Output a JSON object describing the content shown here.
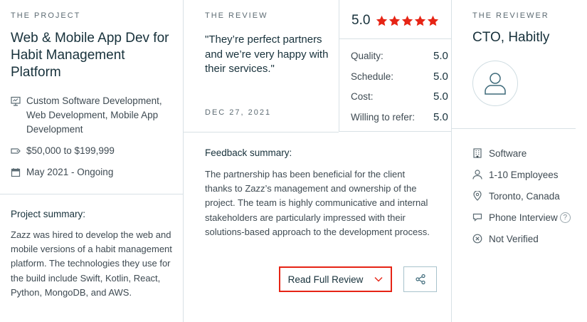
{
  "project": {
    "eyebrow": "THE PROJECT",
    "title": "Web & Mobile App Dev for Habit Management Platform",
    "services": "Custom Software Development, Web Development, Mobile App Development",
    "budget": "$50,000 to $199,999",
    "timeline": "May 2021 - Ongoing",
    "summary_label": "Project summary:",
    "summary_text": "Zazz was hired to develop the web and mobile versions of a habit management platform. The technologies they use for the build include Swift, Kotlin, React, Python, MongoDB, and AWS."
  },
  "review": {
    "eyebrow": "THE REVIEW",
    "quote": "\"They’re perfect partners and we’re very happy with their services.\"",
    "date": "DEC 27, 2021",
    "overall": "5.0",
    "stars": 5,
    "scores": [
      {
        "label": "Quality:",
        "value": "5.0"
      },
      {
        "label": "Schedule:",
        "value": "5.0"
      },
      {
        "label": "Cost:",
        "value": "5.0"
      },
      {
        "label": "Willing to refer:",
        "value": "5.0"
      }
    ],
    "feedback_label": "Feedback summary:",
    "feedback_text": "The partnership has been beneficial for the client thanks to Zazz’s management and ownership of the project. The team is highly communicative and internal stakeholders are particularly impressed with their solutions-based approach to the development process.",
    "read_full_label": "Read Full Review"
  },
  "reviewer": {
    "eyebrow": "THE REVIEWER",
    "title": "CTO, Habitly",
    "industry": "Software",
    "employees": "1-10 Employees",
    "location": "Toronto, Canada",
    "review_type": "Phone Interview",
    "help": "?",
    "verification": "Not Verified"
  },
  "colors": {
    "star": "#e62415",
    "accent_border": "#e62415",
    "heading": "#17313b",
    "body": "#3e4a52",
    "divider": "#d8e1e5"
  }
}
